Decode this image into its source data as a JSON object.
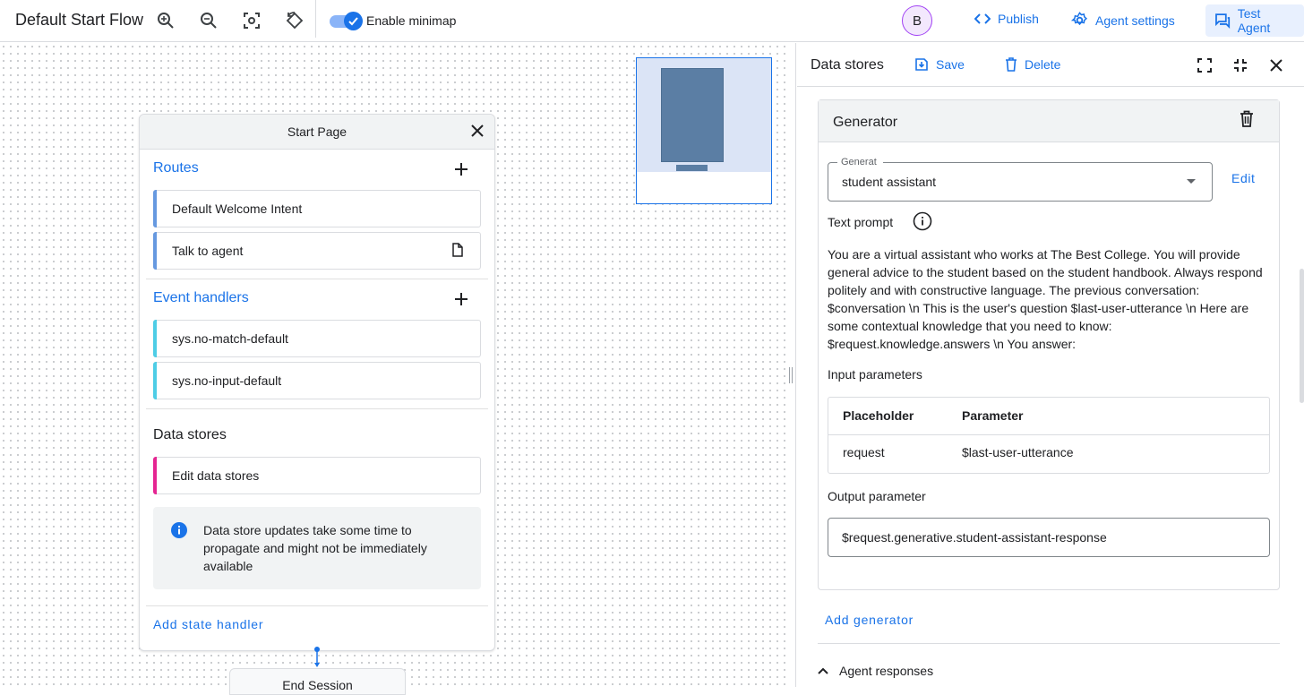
{
  "toolbar": {
    "flow_title": "Default Start Flow",
    "minimap_label": "Enable minimap",
    "minimap_enabled": true,
    "avatar_initial": "B",
    "publish_label": "Publish",
    "agent_settings_label": "Agent settings",
    "test_agent_label": "Test Agent"
  },
  "page_card": {
    "title": "Start Page",
    "routes_title": "Routes",
    "routes": [
      {
        "label": "Default Welcome Intent"
      },
      {
        "label": "Talk to agent"
      }
    ],
    "event_handlers_title": "Event handlers",
    "event_handlers": [
      {
        "label": "sys.no-match-default"
      },
      {
        "label": "sys.no-input-default"
      }
    ],
    "data_stores_title": "Data stores",
    "data_stores_item": "Edit data stores",
    "info_text": "Data store updates take some time to propagate and might not be immediately available",
    "add_state_handler": "Add state handler",
    "end_node": "End Session"
  },
  "panel": {
    "title": "Data stores",
    "save_label": "Save",
    "delete_label": "Delete",
    "generator": {
      "title": "Generator",
      "field_label": "Generat",
      "field_value": "student assistant",
      "edit_label": "Edit",
      "text_prompt_label": "Text prompt",
      "prompt": "You are a virtual assistant who works at The Best College. You will provide general advice to the student based on the student handbook. Always respond politely and with constructive language. The previous conversation: $conversation \\n This is the user's question $last-user-utterance \\n Here are some contextual knowledge that you need to know: $request.knowledge.answers \\n You answer:",
      "input_parameters_label": "Input parameters",
      "table": {
        "headers": [
          "Placeholder",
          "Parameter"
        ],
        "rows": [
          [
            "request",
            "$last-user-utterance"
          ]
        ]
      },
      "output_parameter_label": "Output parameter",
      "output_parameter_value": "$request.generative.student-assistant-response"
    },
    "add_generator": "Add generator",
    "agent_responses": "Agent responses"
  },
  "colors": {
    "accent": "#1a73e8",
    "route_bar": "#6699e0",
    "event_bar": "#4ecde6",
    "datastore_bar": "#e52592"
  }
}
